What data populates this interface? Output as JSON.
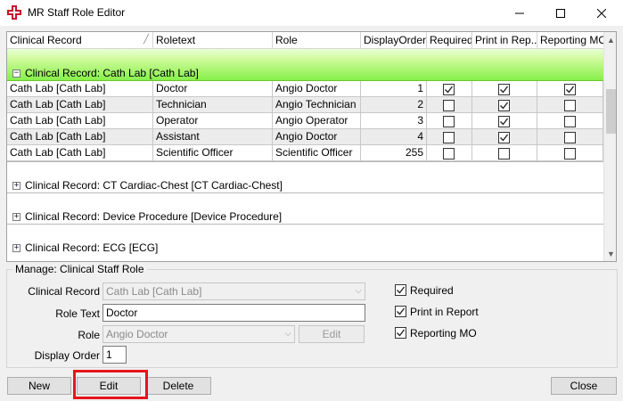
{
  "window": {
    "title": "MR Staff Role Editor",
    "brand_color": "#c8102e",
    "icon": "medical-cross-icon"
  },
  "grid": {
    "columns": [
      "Clinical Record",
      "Roletext",
      "Role",
      "DisplayOrder",
      "Required",
      "Print in Rep...",
      "Reporting MO"
    ],
    "expanded_group": "Clinical Record: Cath Lab [Cath Lab]",
    "group_highlight_color": "#86f04a",
    "rows": [
      {
        "record": "Cath Lab [Cath Lab]",
        "roletext": "Doctor",
        "role": "Angio Doctor",
        "order": "1",
        "required": true,
        "print": true,
        "reporting": true
      },
      {
        "record": "Cath Lab [Cath Lab]",
        "roletext": "Technician",
        "role": "Angio Technician",
        "order": "2",
        "required": false,
        "print": true,
        "reporting": false
      },
      {
        "record": "Cath Lab [Cath Lab]",
        "roletext": "Operator",
        "role": "Angio Operator",
        "order": "3",
        "required": false,
        "print": true,
        "reporting": false
      },
      {
        "record": "Cath Lab [Cath Lab]",
        "roletext": "Assistant",
        "role": "Angio Doctor",
        "order": "4",
        "required": false,
        "print": true,
        "reporting": false
      },
      {
        "record": "Cath Lab [Cath Lab]",
        "roletext": "Scientific Officer",
        "role": "Scientific Officer",
        "order": "255",
        "required": false,
        "print": false,
        "reporting": false
      }
    ],
    "collapsed_groups": [
      "Clinical Record: CT Cardiac-Chest [CT Cardiac-Chest]",
      "Clinical Record: Device Procedure [Device Procedure]",
      "Clinical Record: ECG [ECG]"
    ]
  },
  "manage": {
    "legend": "Manage: Clinical Staff Role",
    "clinical_record_label": "Clinical Record",
    "clinical_record_value": "Cath Lab [Cath Lab]",
    "role_text_label": "Role Text",
    "role_text_value": "Doctor",
    "role_label": "Role",
    "role_value": "Angio Doctor",
    "role_edit_label": "Edit",
    "display_order_label": "Display Order",
    "display_order_value": "1",
    "required_label": "Required",
    "print_label": "Print in Report",
    "reporting_label": "Reporting MO",
    "required_checked": true,
    "print_checked": true,
    "reporting_checked": true
  },
  "buttons": {
    "new": "New",
    "edit": "Edit",
    "delete": "Delete",
    "close": "Close"
  },
  "annotation_color": "#e8141b"
}
